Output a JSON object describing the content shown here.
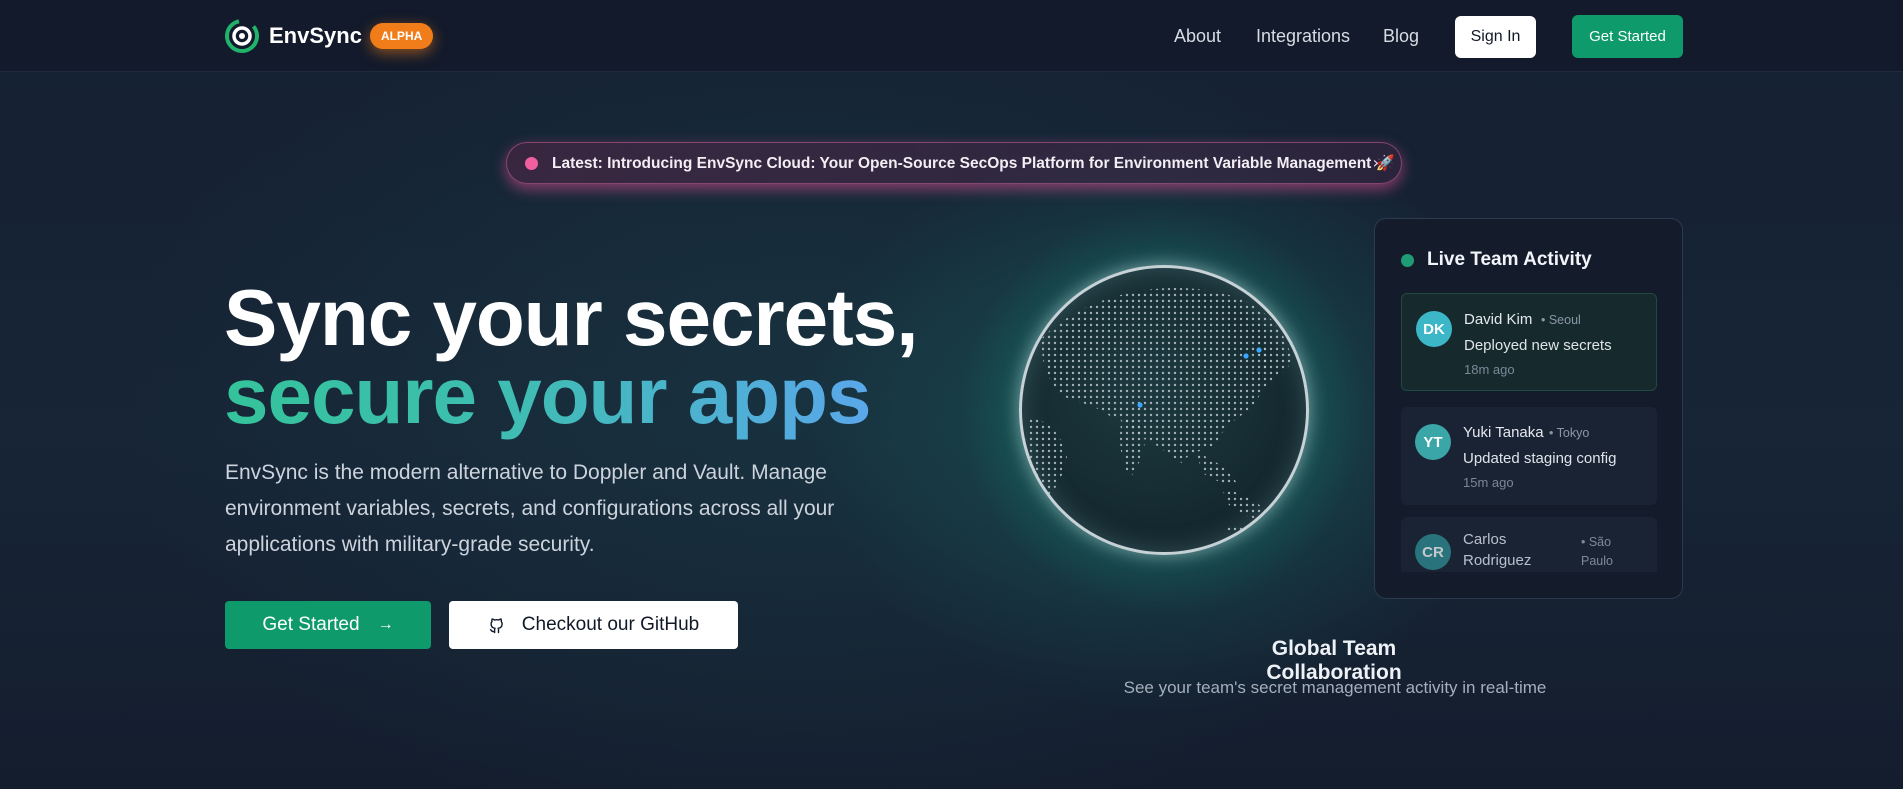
{
  "nav": {
    "brand": "EnvSync",
    "badge": "ALPHA",
    "links": [
      "About",
      "Integrations",
      "Blog"
    ],
    "sign_in": "Sign In",
    "get_started": "Get Started"
  },
  "announcement": {
    "text": "Latest: Introducing EnvSync Cloud: Your Open-Source SecOps Platform for Environment Variable Management 🚀",
    "chevron": "›"
  },
  "hero": {
    "line1": "Sync your secrets,",
    "line2": "secure your apps",
    "description": "EnvSync is the modern alternative to Doppler and Vault. Manage environment variables, secrets, and configurations across all your applications with military-grade security.",
    "primary_button": "Get Started",
    "primary_arrow": "→",
    "secondary_button": "Checkout our GitHub"
  },
  "activity": {
    "title": "Live Team Activity",
    "items": [
      {
        "initials": "DK",
        "name": "David Kim",
        "location": "• Seoul",
        "action": "Deployed new secrets",
        "time": "18m ago",
        "color": "#3cb7c8"
      },
      {
        "initials": "YT",
        "name": "Yuki Tanaka",
        "location": "• Tokyo",
        "action": "Updated staging config",
        "time": "15m ago",
        "color": "#3aa6a8"
      },
      {
        "initials": "CR",
        "name": "Carlos Rodriguez",
        "location": "• São Paulo",
        "action": "",
        "time": "",
        "color": "#2f8f95"
      }
    ]
  },
  "collab": {
    "title": "Global Team Collaboration",
    "subtitle": "See your team's secret management activity in real-time"
  },
  "colors": {
    "accent_green": "#0f9a6b",
    "badge_orange": "#f07d1a",
    "announce_pink": "#f0609f"
  }
}
